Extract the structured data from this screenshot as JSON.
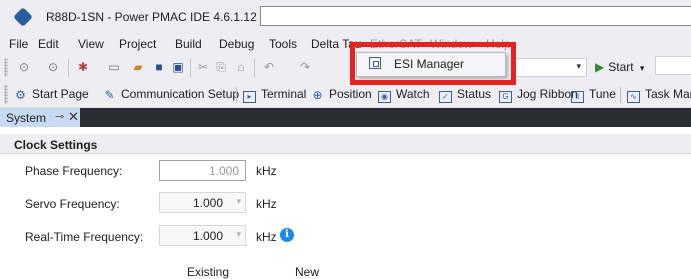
{
  "window": {
    "title": "R88D-1SN - Power PMAC IDE 4.6.1.12"
  },
  "menubar": {
    "items": [
      "File",
      "Edit",
      "View",
      "Project",
      "Build",
      "Debug",
      "Tools",
      "Delta Tau",
      "EtherCAT",
      "Window",
      "Help"
    ]
  },
  "toolbar": {
    "start_label": "Start"
  },
  "toolbar2": {
    "items": [
      {
        "label": "Start Page",
        "icon": "home-icon"
      },
      {
        "label": "Communication Setup",
        "icon": "wrench-icon"
      },
      {
        "label": "Terminal",
        "icon": "terminal-icon"
      },
      {
        "label": "Position",
        "icon": "crosshair-icon"
      },
      {
        "label": "Watch",
        "icon": "eye-icon"
      },
      {
        "label": "Status",
        "icon": "checkbox-icon"
      },
      {
        "label": "Jog Ribbon",
        "icon": "jog-icon"
      },
      {
        "label": "Tune",
        "icon": "tune-icon"
      },
      {
        "label": "Task Mana",
        "icon": "task-manager-icon"
      }
    ]
  },
  "tab": {
    "label": "System",
    "pin": "⊸",
    "close": "✕"
  },
  "popup_menu": {
    "item": "ESI Manager"
  },
  "clock_settings": {
    "title": "Clock Settings",
    "fields": [
      {
        "label": "Phase Frequency:",
        "value": "1.000",
        "unit": "kHz"
      },
      {
        "label": "Servo Frequency:",
        "value": "1.000",
        "unit": "kHz"
      },
      {
        "label": "Real-Time Frequency:",
        "value": "1.000",
        "unit": "kHz"
      }
    ],
    "columns": [
      "Existing",
      "New"
    ]
  },
  "colors": {
    "highlight": "#e6231f",
    "tab_active": "#c6daf2",
    "tab_strip": "#2b2b33",
    "info": "#1e88e5"
  }
}
